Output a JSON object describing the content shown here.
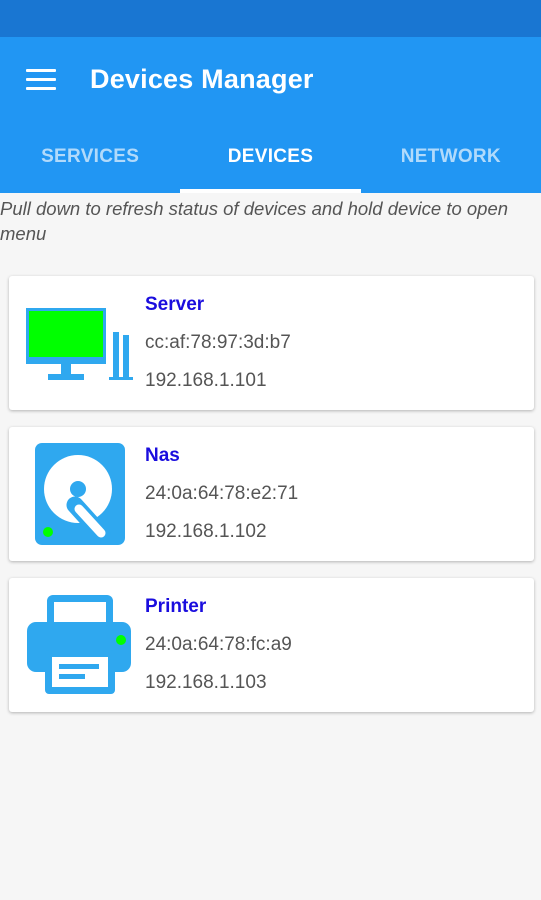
{
  "app": {
    "title": "Devices Manager"
  },
  "tabs": [
    {
      "label": "SERVICES",
      "active": false
    },
    {
      "label": "DEVICES",
      "active": true
    },
    {
      "label": "NETWORK",
      "active": false
    }
  ],
  "hint": "Pull down to refresh status of devices and hold device to open menu",
  "devices": [
    {
      "name": "Server",
      "mac": "cc:af:78:97:3d:b7",
      "ip": "192.168.1.101",
      "icon": "desktop-computer-icon",
      "status_color": "#00ff00"
    },
    {
      "name": "Nas",
      "mac": "24:0a:64:78:e2:71",
      "ip": "192.168.1.102",
      "icon": "hard-drive-icon",
      "status_color": "#00ff00"
    },
    {
      "name": "Printer",
      "mac": "24:0a:64:78:fc:a9",
      "ip": "192.168.1.103",
      "icon": "printer-icon",
      "status_color": "#00ff00"
    }
  ],
  "colors": {
    "status_bar": "#1976d2",
    "primary": "#2196f3",
    "device_name": "#1a0dde",
    "icon_blue": "#2fa8ef",
    "online": "#00ff00"
  }
}
